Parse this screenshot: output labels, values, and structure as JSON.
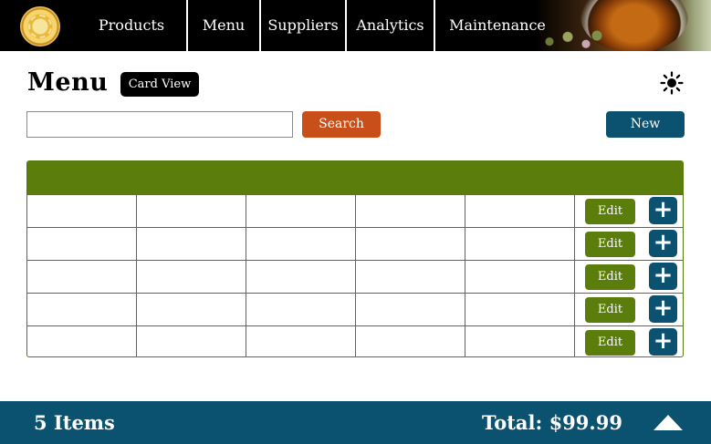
{
  "nav": {
    "items": [
      {
        "label": "Products"
      },
      {
        "label": "Menu"
      },
      {
        "label": "Suppliers"
      },
      {
        "label": "Analytics"
      },
      {
        "label": "Maintenance"
      }
    ]
  },
  "page": {
    "title": "Menu",
    "view_toggle": "Card View",
    "theme_icon": "sun-icon"
  },
  "search": {
    "value": "",
    "placeholder": "",
    "button_label": "Search"
  },
  "new_button_label": "New",
  "table": {
    "rows": [
      {
        "edit_label": "Edit",
        "add_label": "+"
      },
      {
        "edit_label": "Edit",
        "add_label": "+"
      },
      {
        "edit_label": "Edit",
        "add_label": "+"
      },
      {
        "edit_label": "Edit",
        "add_label": "+"
      },
      {
        "edit_label": "Edit",
        "add_label": "+"
      }
    ]
  },
  "footer": {
    "item_count": "5 Items",
    "total": "Total: $99.99",
    "expand_icon": "triangle-up-icon"
  },
  "colors": {
    "nav_bg": "#000000",
    "table_header": "#5a7d0c",
    "search_button": "#c94f1a",
    "primary": "#0b5170",
    "footer_bg": "#0b5170"
  }
}
